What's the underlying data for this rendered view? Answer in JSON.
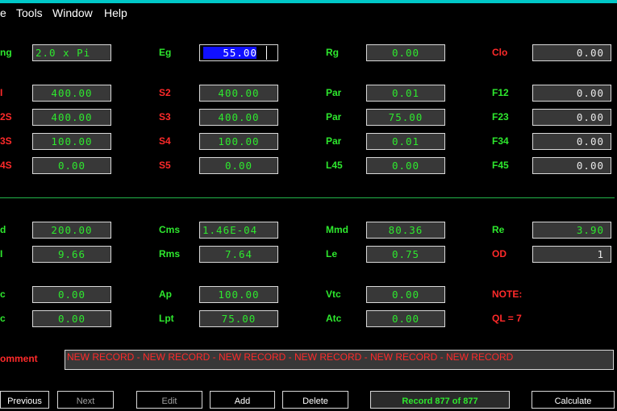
{
  "menu": [
    "e",
    "Tools",
    "Window",
    "Help"
  ],
  "row1": {
    "c1_label": "ng",
    "c1_value": "2.0 x Pi",
    "c2_label": "Eg",
    "c2_value": "55.00",
    "c3_label": "Rg",
    "c3_value": "0.00",
    "c4_label": "Clo",
    "c4_value": "0.00"
  },
  "row2": {
    "c1_label": "I",
    "c1_value": "400.00",
    "c2_label": "S2",
    "c2_value": "400.00",
    "c3_label": "Par",
    "c3_value": "0.01",
    "c4_label": "F12",
    "c4_value": "0.00"
  },
  "row3": {
    "c1_label": "2S",
    "c1_value": "400.00",
    "c2_label": "S3",
    "c2_value": "400.00",
    "c3_label": "Par",
    "c3_value": "75.00",
    "c4_label": "F23",
    "c4_value": "0.00"
  },
  "row4": {
    "c1_label": "3S",
    "c1_value": "100.00",
    "c2_label": "S4",
    "c2_value": "100.00",
    "c3_label": "Par",
    "c3_value": "0.01",
    "c4_label": "F34",
    "c4_value": "0.00"
  },
  "row5": {
    "c1_label": "4S",
    "c1_value": "0.00",
    "c2_label": "S5",
    "c2_value": "0.00",
    "c3_label": "L45",
    "c3_value": "0.00",
    "c4_label": "F45",
    "c4_value": "0.00"
  },
  "row6": {
    "c1_label": "d",
    "c1_value": "200.00",
    "c2_label": "Cms",
    "c2_value": "1.46E-04",
    "c3_label": "Mmd",
    "c3_value": "80.36",
    "c4_label": "Re",
    "c4_value": "3.90"
  },
  "row7": {
    "c1_label": "I",
    "c1_value": "9.66",
    "c2_label": "Rms",
    "c2_value": "7.64",
    "c3_label": "Le",
    "c3_value": "0.75",
    "c4_label": "OD",
    "c4_value": "1"
  },
  "row8": {
    "c1_label": "c",
    "c1_value": "0.00",
    "c2_label": "Ap",
    "c2_value": "100.00",
    "c3_label": "Vtc",
    "c3_value": "0.00",
    "c4_label": "NOTE:"
  },
  "row9": {
    "c1_label": "c",
    "c1_value": "0.00",
    "c2_label": "Lpt",
    "c2_value": "75.00",
    "c3_label": "Atc",
    "c3_value": "0.00",
    "c4_label": "QL = 7"
  },
  "comment": {
    "label": "omment",
    "value": "NEW RECORD - NEW RECORD - NEW RECORD - NEW RECORD - NEW RECORD - NEW RECORD"
  },
  "buttons": {
    "previous": "Previous",
    "next": "Next",
    "edit": "Edit",
    "add": "Add",
    "delete": "Delete",
    "calculate": "Calculate"
  },
  "record_status": "Record 877 of 877"
}
